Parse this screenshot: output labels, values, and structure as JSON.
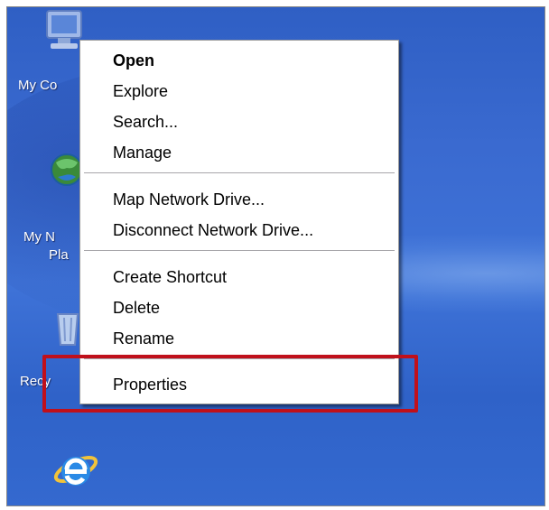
{
  "desktop": {
    "icons": [
      {
        "name": "my-computer",
        "label": "My Co",
        "icon": "computer-icon"
      },
      {
        "name": "my-network-places",
        "label_line1": "My N",
        "label_line2": "Pla",
        "icon": "network-globe-icon"
      },
      {
        "name": "recycle-bin",
        "label": "Recy",
        "icon": "recycle-bin-icon"
      },
      {
        "name": "internet-explorer",
        "icon": "internet-explorer-icon"
      }
    ]
  },
  "context_menu": {
    "group1": [
      "Open",
      "Explore",
      "Search...",
      "Manage"
    ],
    "group2": [
      "Map Network Drive...",
      "Disconnect Network Drive..."
    ],
    "group3": [
      "Create Shortcut",
      "Delete",
      "Rename"
    ],
    "group4": [
      "Properties"
    ],
    "default_item": "Open"
  },
  "annotation": {
    "highlight_color": "#c0101b",
    "highlighted_item": "Properties"
  },
  "colors": {
    "desktop_blue": "#3a6ad0",
    "menu_bg": "#ffffff",
    "separator": "#a7a6aa"
  }
}
